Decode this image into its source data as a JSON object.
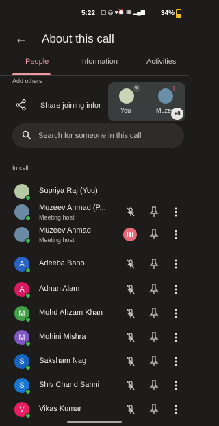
{
  "status_bar": {
    "time": "5:22",
    "battery": "34%"
  },
  "header": {
    "title": "About this call"
  },
  "tabs": [
    {
      "label": "People",
      "active": true
    },
    {
      "label": "Information",
      "active": false
    },
    {
      "label": "Activities",
      "active": false
    }
  ],
  "add_others": "Add others",
  "share": {
    "label": "Share joining infor"
  },
  "pip": {
    "tile1_label": "You",
    "tile2_label": "Muzee",
    "more_count": "+8"
  },
  "search": {
    "placeholder": "Search for someone in this call"
  },
  "in_call_label": "In call",
  "participants": [
    {
      "name": "Supriya Raj (You)",
      "subtitle": "",
      "avatar": "photo",
      "initial": "",
      "color": "#b7c9a4",
      "status": "self"
    },
    {
      "name": "Muzeev Ahmad (P...",
      "subtitle": "Meeting host",
      "avatar": "photo",
      "initial": "",
      "color": "#6a8ba3",
      "status": "muted"
    },
    {
      "name": "Muzeev Ahmad",
      "subtitle": "Meeting host",
      "avatar": "photo",
      "initial": "",
      "color": "#6a8ba3",
      "status": "speaking"
    },
    {
      "name": "Adeeba Bano",
      "subtitle": "",
      "avatar": "initial",
      "initial": "A",
      "color": "#2a63c6",
      "status": "muted"
    },
    {
      "name": "Adnan Alam",
      "subtitle": "",
      "avatar": "initial",
      "initial": "A",
      "color": "#d81b60",
      "status": "muted"
    },
    {
      "name": "Mohd Ahzam Khan",
      "subtitle": "",
      "avatar": "initial",
      "initial": "M",
      "color": "#43a047",
      "status": "muted"
    },
    {
      "name": "Mohini Mishra",
      "subtitle": "",
      "avatar": "initial",
      "initial": "M",
      "color": "#7e57c2",
      "status": "muted"
    },
    {
      "name": "Saksham Nag",
      "subtitle": "",
      "avatar": "initial",
      "initial": "S",
      "color": "#1565c0",
      "status": "muted"
    },
    {
      "name": "Shiv Chand Sahni",
      "subtitle": "",
      "avatar": "initial",
      "initial": "S",
      "color": "#1976d2",
      "status": "muted"
    },
    {
      "name": "Vikas Kumar",
      "subtitle": "",
      "avatar": "initial",
      "initial": "V",
      "color": "#e91e63",
      "status": "muted"
    }
  ],
  "icons": {
    "back": "arrow-left-icon",
    "share": "share-icon",
    "search": "search-icon",
    "mute": "mic-off-icon",
    "pin": "pin-icon",
    "more": "more-vert-icon"
  },
  "colors": {
    "accent": "#ef9aa0",
    "background": "#1e1c1b",
    "online": "#3fb950",
    "speaking": "#e8697a"
  }
}
